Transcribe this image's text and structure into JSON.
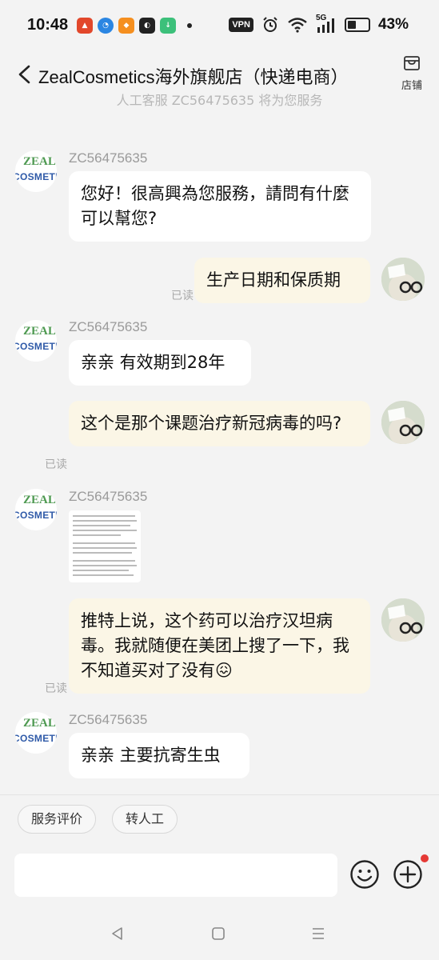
{
  "status_bar": {
    "time": "10:48",
    "vpn": "VPN",
    "network": "5G",
    "battery_pct": "43%",
    "battery_level": 0.43
  },
  "header": {
    "title": "ZealCosmetics海外旗舰店（快递电商）",
    "shop_label": "店铺"
  },
  "system_note": "人工客服 ZC56475635 将为您服务",
  "brand_logo": {
    "line1": "ZEAL",
    "line2": "COSMETICS"
  },
  "messages": {
    "m1": {
      "sender": "ZC56475635",
      "text": "您好！很高興為您服務，請問有什麼可以幫您?"
    },
    "m2": {
      "text": "生产日期和保质期",
      "read": "已读"
    },
    "m3": {
      "sender": "ZC56475635",
      "text": "亲亲 有效期到28年"
    },
    "m4": {
      "text": "这个是那个课题治疗新冠病毒的吗?",
      "read": "已读"
    },
    "m5": {
      "sender": "ZC56475635"
    },
    "m6": {
      "text": "推特上说，这个药可以治疗汉坦病毒。我就随便在美团上搜了一下，我不知道买对了没有😖",
      "read": "已读"
    },
    "m7": {
      "sender": "ZC56475635",
      "text": "亲亲 主要抗寄生虫"
    }
  },
  "quick_replies": [
    "服务评价",
    "转人工"
  ],
  "colors": {
    "background": "#f3f3f3",
    "incoming_bubble": "#ffffff",
    "outgoing_bubble": "#fbf6e6",
    "badge_red": "#e53935"
  }
}
